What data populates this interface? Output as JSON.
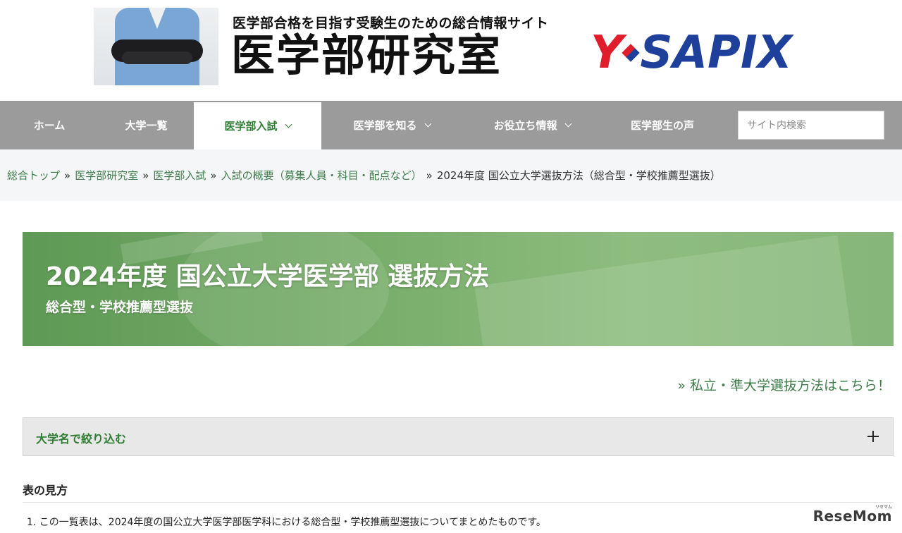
{
  "header": {
    "tagline": "医学部合格を目指す受験生のための総合情報サイト",
    "site_title": "医学部研究室",
    "brand_y": "Y",
    "brand_sapix": "SAPIX",
    "colors": {
      "brand_red": "#e01e2b",
      "brand_blue": "#1e3f9a"
    }
  },
  "nav": {
    "items": [
      {
        "label": "ホーム",
        "active": false,
        "dropdown": false
      },
      {
        "label": "大学一覧",
        "active": false,
        "dropdown": false
      },
      {
        "label": "医学部入試",
        "active": true,
        "dropdown": true
      },
      {
        "label": "医学部を知る",
        "active": false,
        "dropdown": true
      },
      {
        "label": "お役立ち情報",
        "active": false,
        "dropdown": true
      },
      {
        "label": "医学部生の声",
        "active": false,
        "dropdown": false
      }
    ],
    "search_placeholder": "サイト内検索",
    "colors": {
      "bar": "#9b9b9b",
      "active_text": "#2e7d32"
    }
  },
  "breadcrumb": {
    "links": [
      "総合トップ",
      "医学部研究室",
      "医学部入試",
      "入試の概要（募集人員・科目・配点など）"
    ],
    "separator": "»",
    "current": "2024年度 国公立大学選抜方法（総合型・学校推薦型選抜）",
    "link_color": "#3f7d4a"
  },
  "banner": {
    "title": "2024年度 国公立大学医学部 選抜方法",
    "subtitle": "総合型・学校推薦型選抜"
  },
  "private_link": "» 私立・準大学選抜方法はこちら！",
  "filter": {
    "label": "大学名で絞り込む",
    "icon": "plus-icon"
  },
  "how_to_read": {
    "heading": "表の見方",
    "items": [
      "1. この一覧表は、2024年度の国公立大学医学部医学科における総合型・学校推薦型選抜についてまとめたものです。"
    ]
  },
  "watermark": {
    "text": "ReseMom",
    "small": "リセマム"
  }
}
